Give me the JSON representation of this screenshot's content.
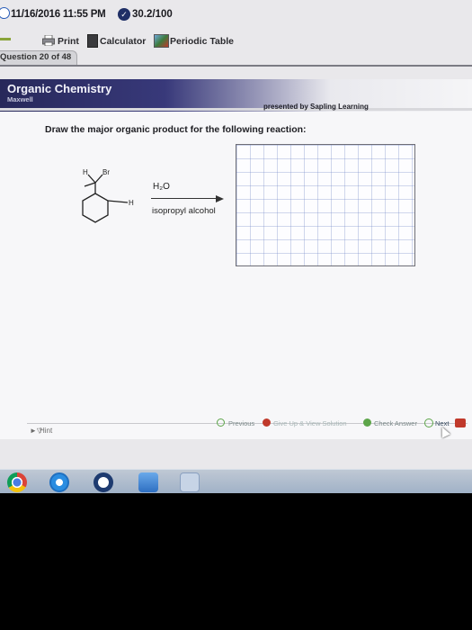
{
  "status": {
    "datetime": "11/16/2016 11:55 PM",
    "score": "30.2/100"
  },
  "toolbar": {
    "print_label": "Print",
    "calculator_label": "Calculator",
    "periodic_label": "Periodic Table"
  },
  "question": {
    "label": "Question 20 of 48"
  },
  "header": {
    "course_title": "Organic Chemistry",
    "course_subtitle": "Maxwell",
    "presented_by": "presented by Sapling Learning"
  },
  "main": {
    "instruction": "Draw the major organic product for the following reaction:",
    "molecule_labels": {
      "h_top": "H",
      "br": "Br",
      "h_side": "H"
    },
    "reagent_top": "H₂O",
    "reagent_bottom": "isopropyl alcohol"
  },
  "footer": {
    "hint_label": "Hint",
    "previous_label": "Previous",
    "give_up_label": "Give Up & View Solution",
    "check_answer_label": "Check Answer",
    "next_label": "Next",
    "exit_label": "Exit"
  },
  "icons": {
    "clock": "clock-icon",
    "score": "score-icon",
    "print": "printer-icon",
    "calculator": "calculator-icon",
    "periodic": "periodic-table-icon"
  },
  "colors": {
    "header_dark": "#27285a",
    "accent_green": "#5da54a",
    "accent_red": "#c0392b"
  }
}
